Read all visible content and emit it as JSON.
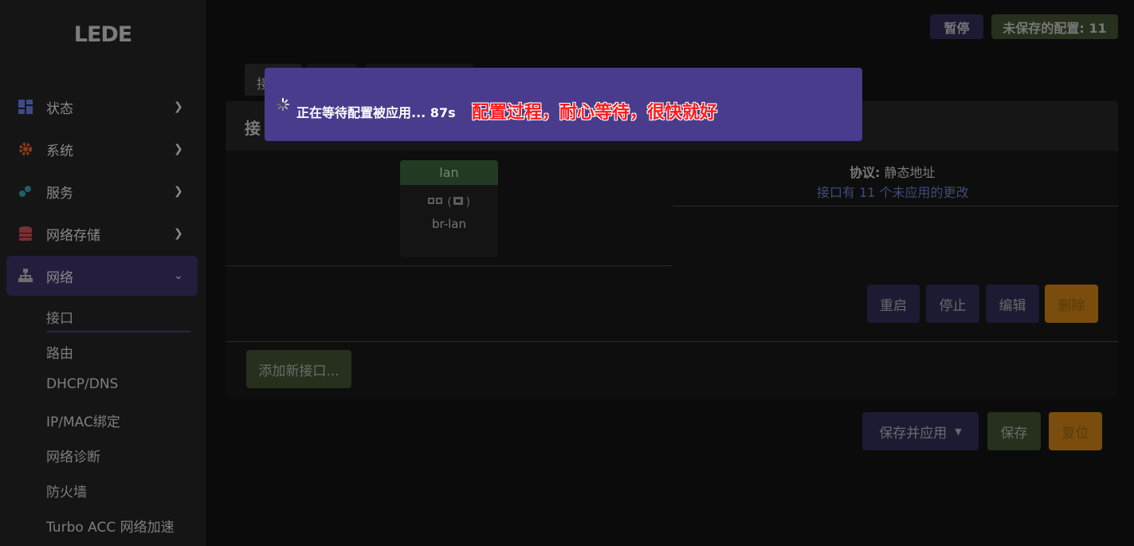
{
  "app": {
    "logo": "LEDE"
  },
  "topbar": {
    "pause_label": "暂停",
    "unsaved_label": "未保存的配置: 11"
  },
  "sidebar": {
    "items": [
      {
        "label": "状态",
        "icon": "dashboard-icon"
      },
      {
        "label": "系统",
        "icon": "gear-icon"
      },
      {
        "label": "服务",
        "icon": "puzzle-icon"
      },
      {
        "label": "网络存储",
        "icon": "database-icon"
      },
      {
        "label": "网络",
        "icon": "sitemap-icon"
      }
    ],
    "subitems": [
      "接口",
      "路由",
      "DHCP/DNS",
      "IP/MAC绑定",
      "网络诊断",
      "防火墙",
      "Turbo ACC 网络加速"
    ]
  },
  "main": {
    "tab_partial": "接",
    "panel_title_partial": "接",
    "interface": {
      "name": "lan",
      "icons_text": "(    )",
      "device": "br-lan",
      "protocol_label": "协议:",
      "protocol_value": "静态地址",
      "pending_text": "接口有 11 个未应用的更改"
    },
    "buttons": {
      "restart": "重启",
      "stop": "停止",
      "edit": "编辑",
      "delete": "删除",
      "add": "添加新接口...",
      "save_apply": "保存并应用",
      "save": "保存",
      "reset": "复位"
    }
  },
  "modal": {
    "status_text": "正在等待配置被应用... 87s",
    "note": "配置过程，耐心等待，很快就好"
  },
  "colors": {
    "modal_bg": "#4a3c8c",
    "note_red": "#ff1a1a",
    "accent_orange": "#8a5a0e",
    "accent_green": "#2e3a1f",
    "accent_purple": "#241d3d"
  }
}
